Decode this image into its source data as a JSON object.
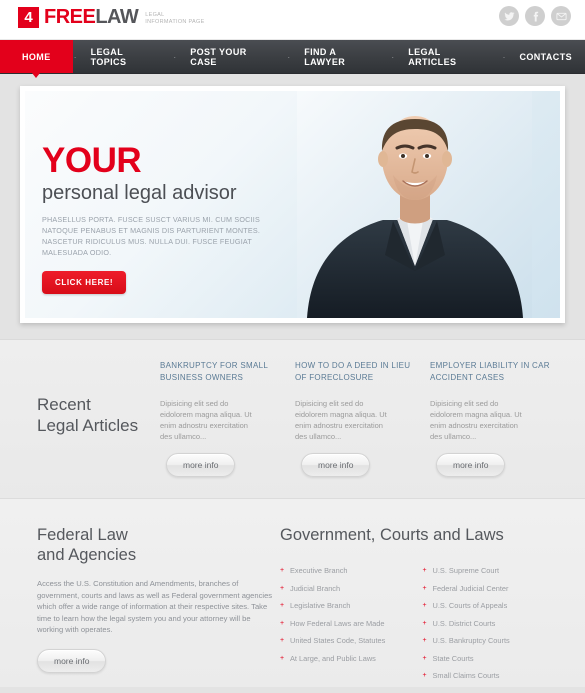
{
  "header": {
    "logo": {
      "badge": "4",
      "name_accent": "FREE",
      "name_rest": "LAW",
      "tagline_line1": "LEGAL",
      "tagline_line2": "INFORMATION PAGE"
    },
    "social": [
      {
        "name": "twitter-icon",
        "label": "Twitter"
      },
      {
        "name": "facebook-icon",
        "label": "Facebook"
      },
      {
        "name": "email-icon",
        "label": "Email"
      }
    ]
  },
  "nav": {
    "items": [
      {
        "label": "HOME",
        "active": true
      },
      {
        "label": "LEGAL TOPICS",
        "active": false
      },
      {
        "label": "POST YOUR CASE",
        "active": false
      },
      {
        "label": "FIND A LAWYER",
        "active": false
      },
      {
        "label": "LEGAL ARTICLES",
        "active": false
      },
      {
        "label": "CONTACTS",
        "active": false
      }
    ],
    "separator": "·"
  },
  "hero": {
    "title": "YOUR",
    "subtitle": "personal legal advisor",
    "description": "PHASELLUS PORTA. FUSCE SUSCT VARIUS MI. CUM SOCIIS NATOQUE PENABUS ET MAGNIS DIS PARTURIENT MONTES. NASCETUR RIDICULUS MUS. NULLA DUI. FUSCE FEUGIAT MALESUADA ODIO.",
    "cta_label": "CLICK HERE!"
  },
  "recent_articles": {
    "heading_line1": "Recent",
    "heading_line2": "Legal Articles",
    "more_label": "more info",
    "items": [
      {
        "title": "BANKRUPTCY FOR SMALL BUSINESS OWNERS",
        "body": "Dipisicing elit sed do eidolorem magna aliqua. Ut enim adnostru exercitation des ullamco..."
      },
      {
        "title": "HOW TO DO A DEED IN LIEU OF FORECLOSURE",
        "body": "Dipisicing elit sed do eidolorem magna aliqua. Ut enim adnostru exercitation des ullamco..."
      },
      {
        "title": "EMPLOYER LIABILITY IN CAR ACCIDENT CASES",
        "body": "Dipisicing elit sed do eidolorem magna aliqua. Ut enim adnostru exercitation des ullamco..."
      }
    ]
  },
  "federal_law": {
    "heading_line1": "Federal Law",
    "heading_line2": "and Agencies",
    "body": "Access the U.S. Constitution and Amendments, branches of government, courts and laws as well as Federal government agencies which offer a wide range of information at their respective sites. Take time to learn how the legal system you and your attorney will be working with operates.",
    "more_label": "more info"
  },
  "government": {
    "heading": "Government, Courts and Laws",
    "bullet": "+",
    "column_left": [
      "Executive Branch",
      "Judicial Branch",
      "Legislative Branch",
      "How Federal Laws are Made",
      "United States Code, Statutes",
      "At Large, and Public Laws"
    ],
    "column_right": [
      "U.S. Supreme Court",
      "Federal Judicial Center",
      "U.S. Courts of Appeals",
      "U.S. District Courts",
      "U.S. Bankruptcy Courts",
      "State Courts",
      "Small Claims Courts"
    ]
  },
  "colors": {
    "accent_red": "#e3001b",
    "nav_dark": "#3c3f43",
    "article_title": "#5b7b95",
    "heading_gray": "#55585d"
  }
}
